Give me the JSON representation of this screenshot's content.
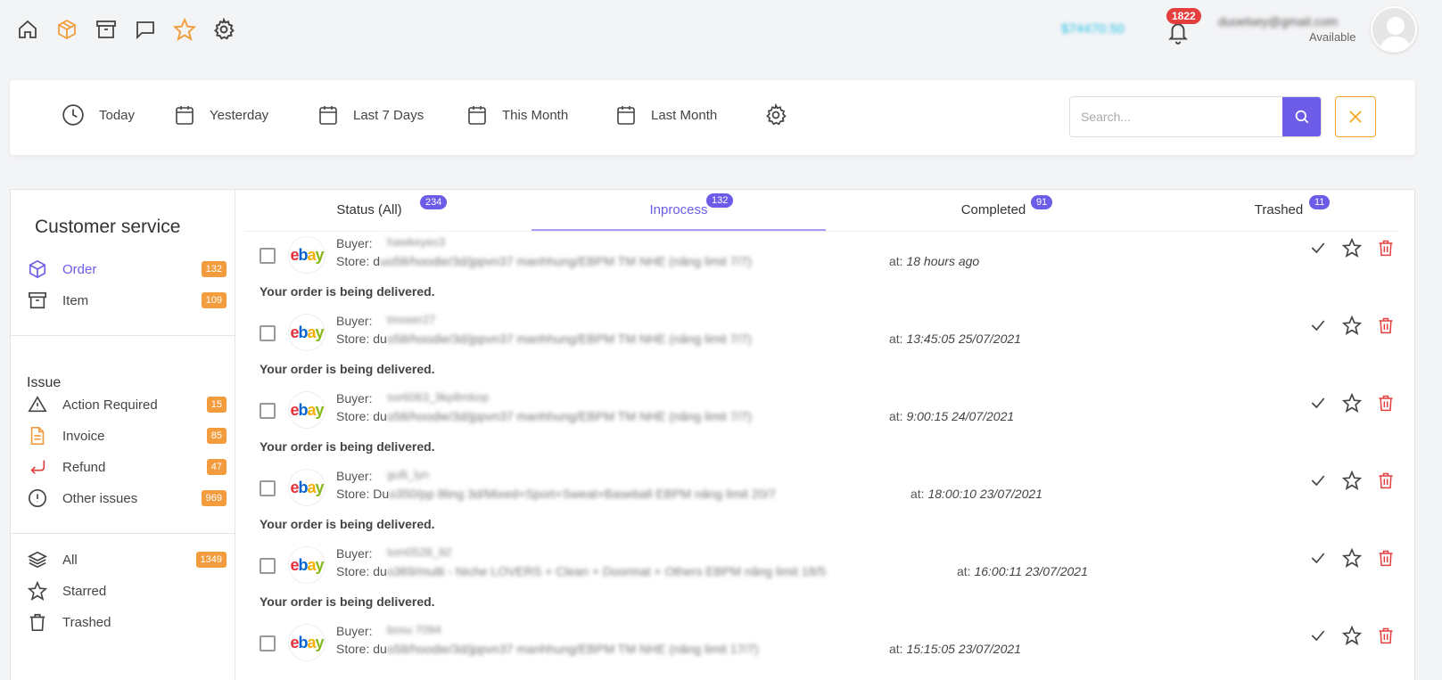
{
  "topbar": {
    "balance": "$74470.50",
    "notification_count": "1822",
    "user_email": "duoelsey@gmail.com",
    "user_status": "Available"
  },
  "filters": {
    "today": "Today",
    "yesterday": "Yesterday",
    "last7": "Last 7 Days",
    "this_month": "This Month",
    "last_month": "Last Month"
  },
  "search": {
    "placeholder": "Search..."
  },
  "sidebar": {
    "title": "Customer service",
    "items": [
      {
        "label": "Order",
        "count": "132"
      },
      {
        "label": "Item",
        "count": "109"
      }
    ],
    "issue_title": "Issue",
    "issues": [
      {
        "label": "Action Required",
        "count": "15"
      },
      {
        "label": "Invoice",
        "count": "85"
      },
      {
        "label": "Refund",
        "count": "47"
      },
      {
        "label": "Other issues",
        "count": "969"
      }
    ],
    "bottom": [
      {
        "label": "All",
        "count": "1349"
      },
      {
        "label": "Starred"
      },
      {
        "label": "Trashed"
      }
    ]
  },
  "tabs": [
    {
      "label": "Status (All)",
      "count": "234"
    },
    {
      "label": "Inprocess",
      "count": "132"
    },
    {
      "label": "Completed",
      "count": "91"
    },
    {
      "label": "Trashed",
      "count": "11"
    }
  ],
  "orders": [
    {
      "buyer_label": "Buyer:",
      "buyer": "hawkeyes3",
      "store_prefix": "Store: d",
      "store_rest": "uo58/hoodie/3d/jppvn37 manhhung/EBPM TM NHE (nâng limit 7/7)",
      "at_label": "at:",
      "time": "18 hours ago",
      "message": "Your order is being delivered."
    },
    {
      "buyer_label": "Buyer:",
      "buyer": "tmoser27",
      "store_prefix": "Store: du",
      "store_rest": "o58/hoodie/3d/jppvn37 manhhung/EBPM TM NHE (nâng limit 7/7)",
      "at_label": "at:",
      "time": "13:45:05 25/07/2021",
      "message": "Your order is being delivered."
    },
    {
      "buyer_label": "Buyer:",
      "buyer": "sor6063_9kp8mkop",
      "store_prefix": "Store: du",
      "store_rest": "o58/hoodie/3d/jppvn37 manhhung/EBPM TM NHE (nâng limit 7/7)",
      "at_label": "at:",
      "time": "9:00:15 24/07/2021",
      "message": "Your order is being delivered."
    },
    {
      "buyer_label": "Buyer:",
      "buyer": "gulli_lyn",
      "store_prefix": "Store: Du",
      "store_rest": "o350/pp 8ling 3d/Mixed+Sport+Sweat+Baseball EBPM nâng limit 20/7",
      "at_label": "at:",
      "time": "18:00:10 23/07/2021",
      "message": "Your order is being delivered."
    },
    {
      "buyer_label": "Buyer:",
      "buyer": "tom0528_92",
      "store_prefix": "Store: du",
      "store_rest": "o369/multi - Niche LOVERS + Clean + Doormat + Others EBPM nâng limit 18/5",
      "at_label": "at:",
      "time": "16:00:11 23/07/2021",
      "message": "Your order is being delivered."
    },
    {
      "buyer_label": "Buyer:",
      "buyer": "bosu 7094",
      "store_prefix": "Store: du",
      "store_rest": "o58/hoodie/3d/jppvn37 manhhung/EBPM TM NHE (nâng limit 17/7)",
      "at_label": "at:",
      "time": "15:15:05 23/07/2021",
      "message": ""
    }
  ],
  "colors": {
    "accent": "#6c5ce7",
    "badge": "#f39c3d",
    "danger": "#e53e3e",
    "star": "#f5a623"
  }
}
